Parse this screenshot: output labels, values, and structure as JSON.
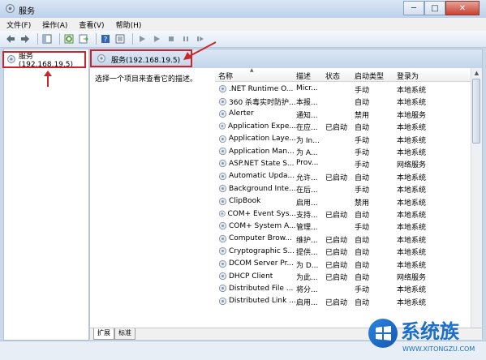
{
  "window": {
    "title": "服务",
    "minimize": "─",
    "maximize": "□",
    "close": "✕"
  },
  "menu": [
    "文件(F)",
    "操作(A)",
    "查看(V)",
    "帮助(H)"
  ],
  "toolbar_icons": [
    "back-arrow-icon",
    "forward-arrow-icon",
    "show-hide-tree-icon",
    "refresh-icon",
    "export-list-icon",
    "help-icon",
    "properties-icon",
    "start-service-icon",
    "start-icon",
    "stop-icon",
    "pause-icon",
    "restart-icon"
  ],
  "tree": {
    "root_label": "服务(192.168.19.5)"
  },
  "main": {
    "header_title": "服务(192.168.19.5)",
    "description": "选择一个项目来查看它的描述。",
    "columns": [
      "名称",
      "描述",
      "状态",
      "启动类型",
      "登录为"
    ],
    "rows": [
      {
        "name": ".NET Runtime O...",
        "desc": "Micr...",
        "state": "",
        "start": "手动",
        "login": "本地系统"
      },
      {
        "name": "360 杀毒实时防护...",
        "desc": "本报...",
        "state": "",
        "start": "自动",
        "login": "本地系统"
      },
      {
        "name": "Alerter",
        "desc": "通知...",
        "state": "",
        "start": "禁用",
        "login": "本地服务"
      },
      {
        "name": "Application Expe...",
        "desc": "在应...",
        "state": "已启动",
        "start": "自动",
        "login": "本地系统"
      },
      {
        "name": "Application Laye...",
        "desc": "为 In...",
        "state": "",
        "start": "手动",
        "login": "本地系统"
      },
      {
        "name": "Application Man...",
        "desc": "为 A...",
        "state": "",
        "start": "手动",
        "login": "本地系统"
      },
      {
        "name": "ASP.NET State S...",
        "desc": "Prov...",
        "state": "",
        "start": "手动",
        "login": "网络服务"
      },
      {
        "name": "Automatic Upda...",
        "desc": "允许...",
        "state": "已启动",
        "start": "自动",
        "login": "本地系统"
      },
      {
        "name": "Background Inte...",
        "desc": "在后...",
        "state": "",
        "start": "手动",
        "login": "本地系统"
      },
      {
        "name": "ClipBook",
        "desc": "启用...",
        "state": "",
        "start": "禁用",
        "login": "本地系统"
      },
      {
        "name": "COM+ Event Sys...",
        "desc": "支持...",
        "state": "已启动",
        "start": "自动",
        "login": "本地系统"
      },
      {
        "name": "COM+ System A...",
        "desc": "管理...",
        "state": "",
        "start": "手动",
        "login": "本地系统"
      },
      {
        "name": "Computer Brow...",
        "desc": "维护...",
        "state": "已启动",
        "start": "自动",
        "login": "本地系统"
      },
      {
        "name": "Cryptographic S...",
        "desc": "提供...",
        "state": "已启动",
        "start": "自动",
        "login": "本地系统"
      },
      {
        "name": "DCOM Server Pr...",
        "desc": "为 D...",
        "state": "已启动",
        "start": "自动",
        "login": "本地系统"
      },
      {
        "name": "DHCP Client",
        "desc": "为此...",
        "state": "已启动",
        "start": "自动",
        "login": "网络服务"
      },
      {
        "name": "Distributed File ...",
        "desc": "将分...",
        "state": "",
        "start": "手动",
        "login": "本地系统"
      },
      {
        "name": "Distributed Link ...",
        "desc": "启用...",
        "state": "已启动",
        "start": "自动",
        "login": "本地系统"
      }
    ],
    "tabs": [
      "扩展",
      "标准"
    ]
  },
  "watermark": {
    "brand": "系统族",
    "url": "WWW.XITONGZU.COM"
  },
  "colors": {
    "highlight": "#c8262c",
    "title_bar": "#bdd1ea",
    "logo_blue": "#1b6fc8"
  }
}
